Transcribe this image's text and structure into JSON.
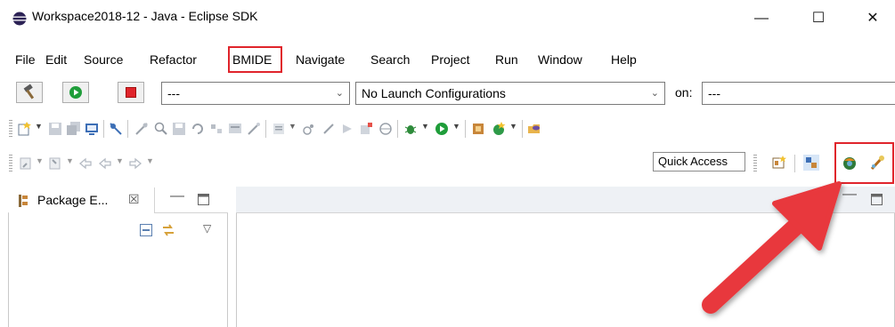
{
  "window": {
    "title": "Workspace2018-12 - Java - Eclipse SDK",
    "minimize": "—",
    "maximize": "☐",
    "close": "✕"
  },
  "menu": {
    "file": "File",
    "edit": "Edit",
    "source": "Source",
    "refactor": "Refactor",
    "bmide": "BMIDE",
    "navigate": "Navigate",
    "search": "Search",
    "project": "Project",
    "run": "Run",
    "window": "Window",
    "help": "Help"
  },
  "launch": {
    "mode_value": "---",
    "configuration_value": "No Launch Configurations",
    "on_label": "on:",
    "target_value": "---"
  },
  "quick_access": "Quick Access",
  "package_explorer": {
    "tab_label": "Package E...",
    "close": "☒"
  },
  "colors": {
    "highlight": "#e0242b",
    "arrow": "#e8383c",
    "run_green": "#1f9d3a",
    "stop_red": "#e0242b"
  }
}
